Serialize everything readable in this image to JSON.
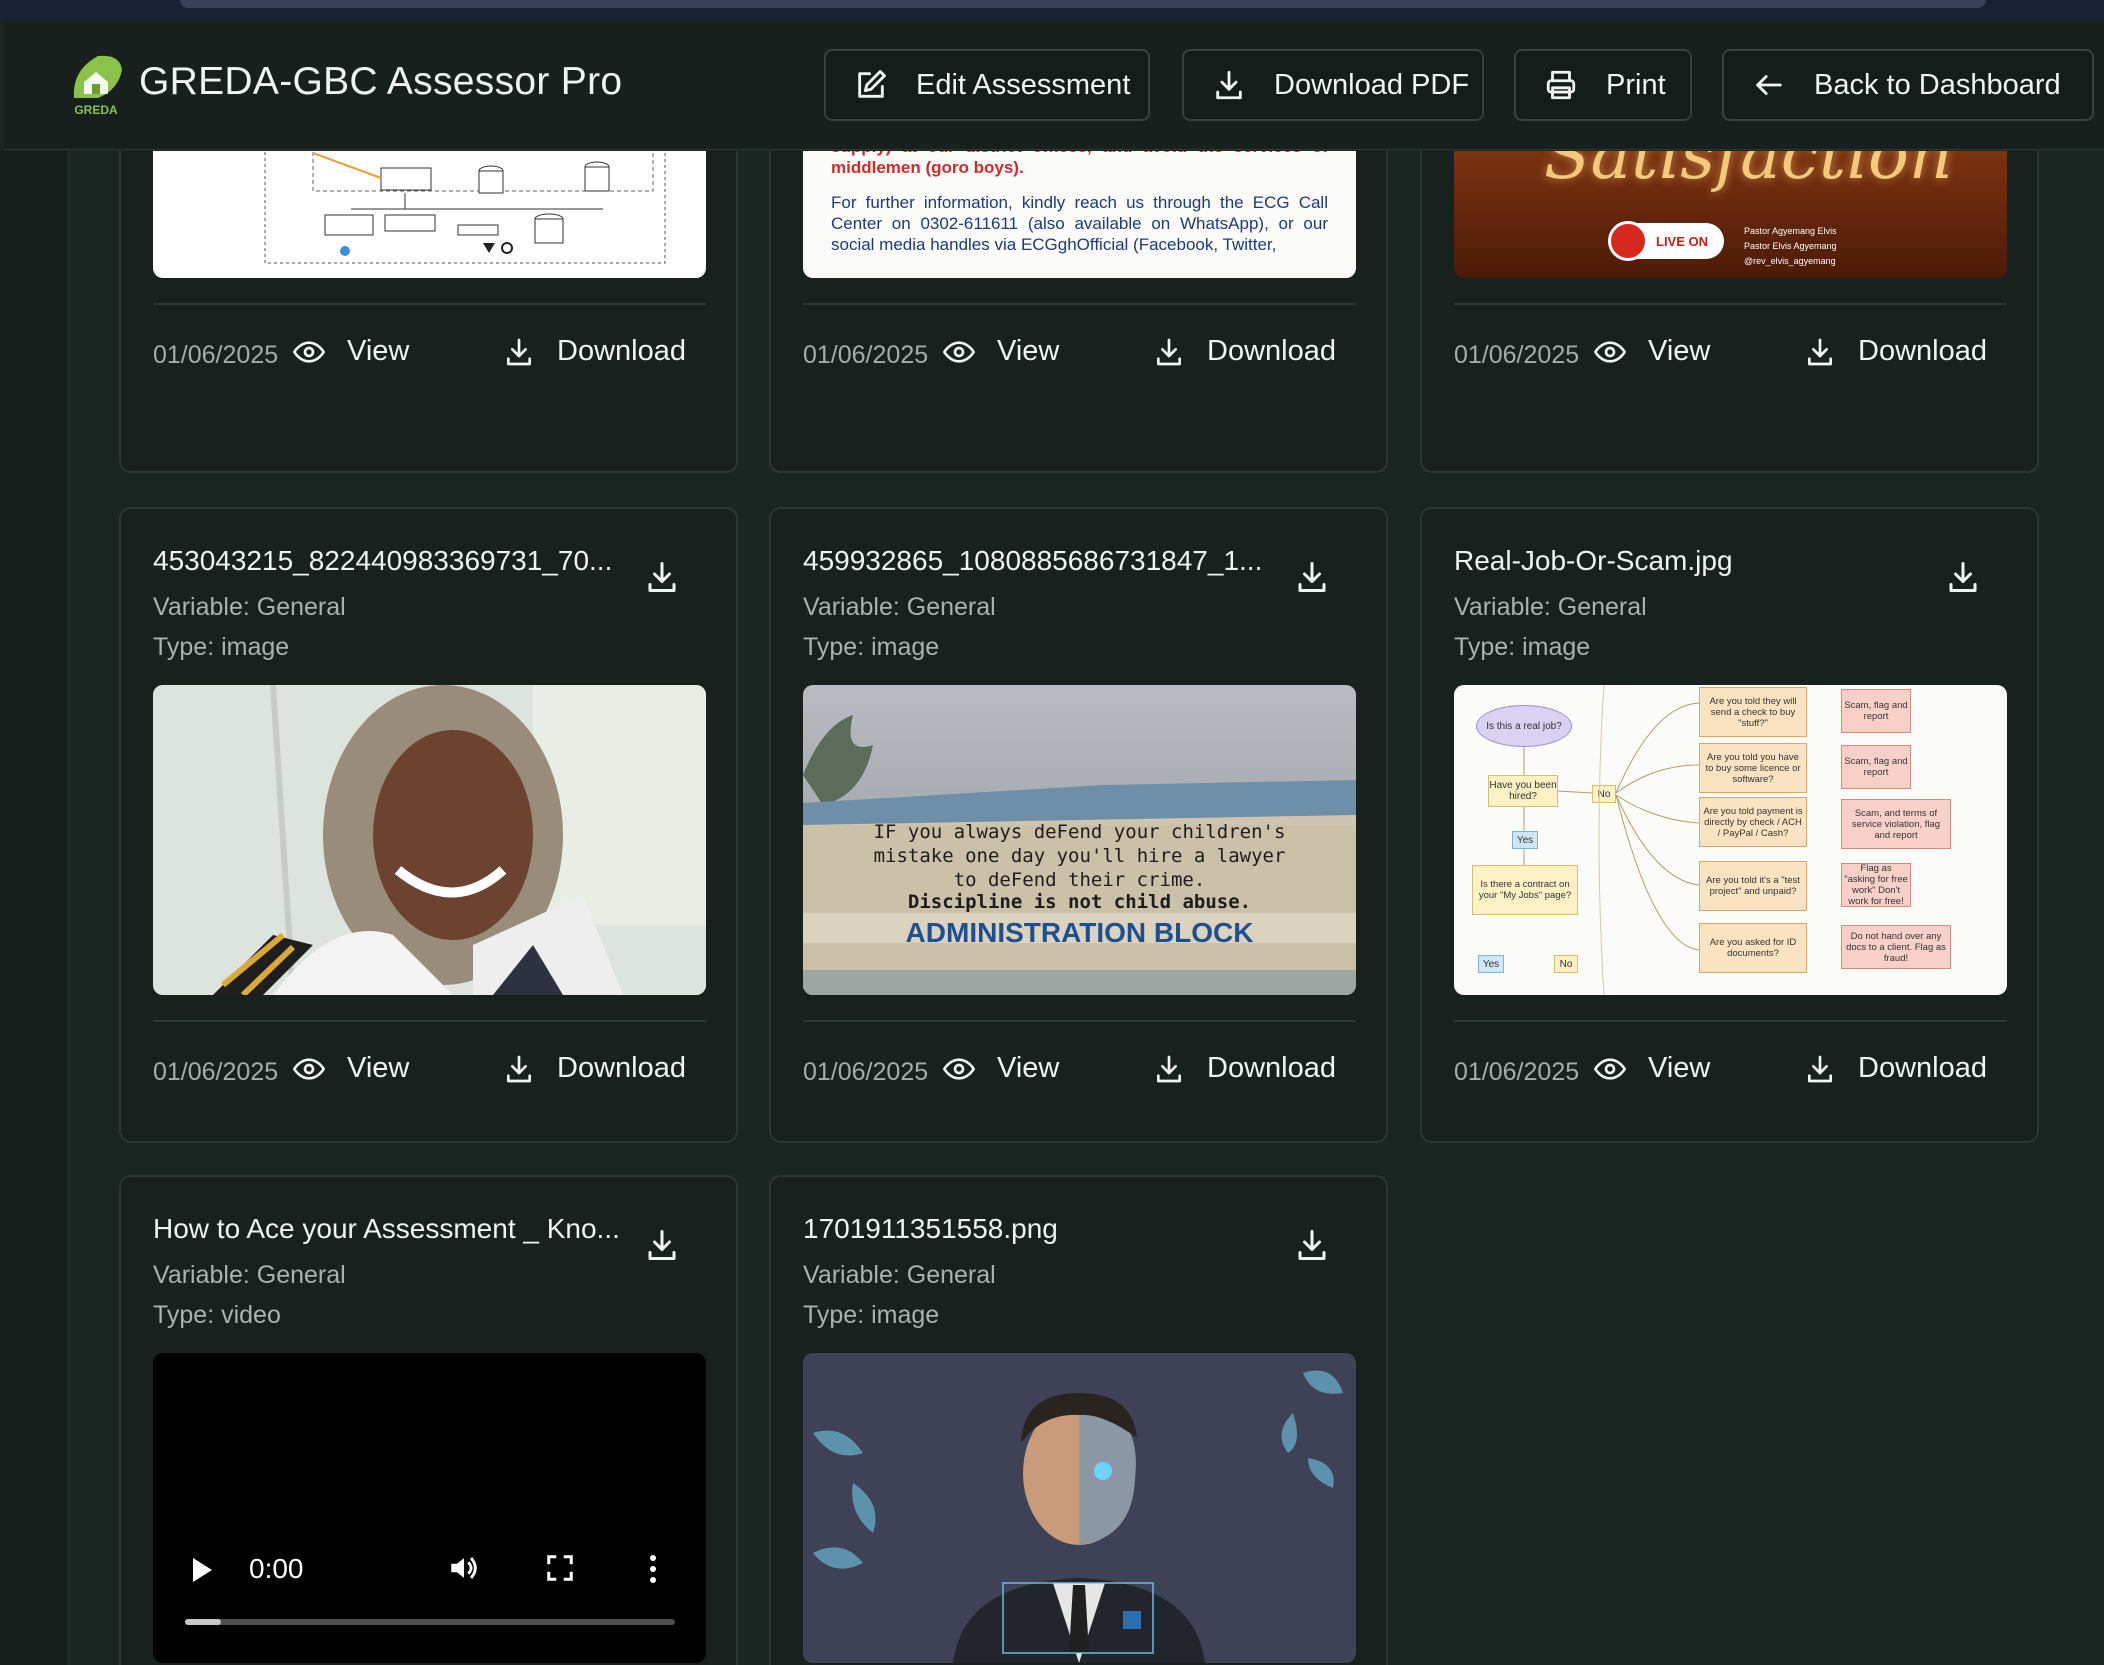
{
  "app": {
    "title": "GREDA-GBC Assessor Pro",
    "logo_text": "GREDA",
    "accent_color": "#7cb342"
  },
  "header": {
    "buttons": [
      {
        "label": "Edit Assessment",
        "icon": "edit-icon"
      },
      {
        "label": "Download PDF",
        "icon": "download-icon"
      },
      {
        "label": "Print",
        "icon": "printer-icon"
      },
      {
        "label": "Back to Dashboard",
        "icon": "arrow-left-icon"
      }
    ]
  },
  "actions": {
    "view_label": "View",
    "download_label": "Download"
  },
  "cards": [
    {
      "title": "",
      "variable": "",
      "type": "",
      "date": "01/06/2025",
      "thumbnail": "architecture-diagram"
    },
    {
      "title": "",
      "variable": "",
      "type": "",
      "date": "01/06/2025",
      "thumbnail": "ecg-notice",
      "notice_red": "Customers are encouraged to ONLY apply for service (power supply) at our district offices, and avoid the services of middlemen (goro boys).",
      "notice_blue": "For further information, kindly reach us through the ECG Call Center on 0302-611611 (also available on WhatsApp), or our social media handles via ECGghOfficial (Facebook, Twitter,"
    },
    {
      "title": "",
      "variable": "",
      "type": "",
      "date": "01/06/2025",
      "thumbnail": "satisfaction-flyer",
      "flyer_word": "Satisfaction",
      "live_label": "LIVE ON",
      "flyer_lines": [
        "Pastor Agyemang Elvis",
        "Pastor Elvis Agyemang",
        "@rev_elvis_agyemang"
      ]
    },
    {
      "title": "453043215_822440983369731_70...",
      "variable": "Variable: General",
      "type": "Type: image",
      "date": "01/06/2025",
      "thumbnail": "pilot-portrait"
    },
    {
      "title": "459932865_1080885686731847_1...",
      "variable": "Variable: General",
      "type": "Type: image",
      "date": "01/06/2025",
      "thumbnail": "administration-block",
      "sign_lines": [
        "IF you always deFend your children's",
        "mistake one day you'll hire a lawyer",
        "to deFend their crime.",
        "Discipline is not child abuse."
      ],
      "block_text": "ADMINISTRATION BLOCK"
    },
    {
      "title": "Real-Job-Or-Scam.jpg",
      "variable": "Variable: General",
      "type": "Type: image",
      "date": "01/06/2025",
      "thumbnail": "scam-flowchart",
      "flow": {
        "start": "Is this a real job?",
        "hired": "Have you been hired?",
        "yes": "Yes",
        "no": "No",
        "contract": "Is there a contract on your \"My Jobs\" page?",
        "questions": [
          "Are you told they will send a check to buy \"stuff?\"",
          "Are you told you have to buy some licence or software?",
          "Are you told payment is directly by check / ACH / PayPal / Cash?",
          "Are you told it's a \"test project\" and unpaid?",
          "Are you asked for ID documents?"
        ],
        "outcomes": [
          "Scam, flag and report",
          "Scam, flag and report",
          "Scam, and terms of service violation, flag and report",
          "Flag as \"asking for free work\" Don't work for free!",
          "Do not hand over any docs to a client. Flag as fraud!"
        ]
      }
    },
    {
      "title": "How to Ace your Assessment _ Kno...",
      "variable": "Variable: General",
      "type": "Type: video",
      "date": "",
      "thumbnail": "video-player",
      "video_time": "0:00"
    },
    {
      "title": "1701911351558.png",
      "variable": "Variable: General",
      "type": "Type: image",
      "date": "",
      "thumbnail": "cyborg-portrait"
    }
  ]
}
